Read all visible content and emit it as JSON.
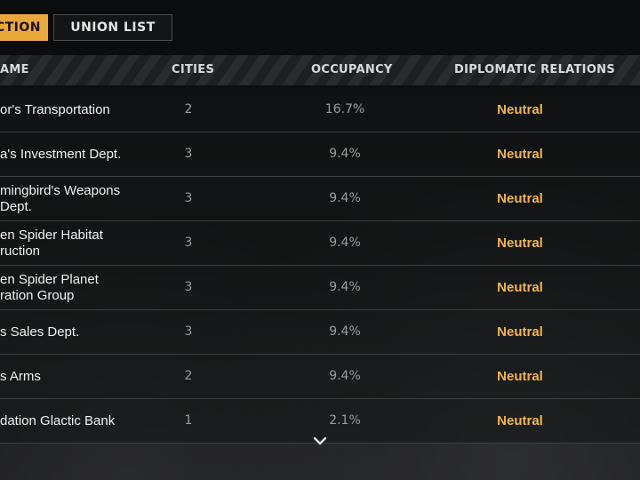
{
  "tabs": {
    "faction_label": "ACTION",
    "union_label": "UNION LIST"
  },
  "columns": {
    "name": "AME",
    "cities": "CITIES",
    "occupancy": "OCCUPANCY",
    "relations": "DIPLOMATIC RELATIONS"
  },
  "rows": [
    {
      "name": "or's Transportation\n ",
      "cities": "2",
      "occupancy": "16.7%",
      "relation": "Neutral"
    },
    {
      "name": "a's Investment Dept.",
      "cities": "3",
      "occupancy": "9.4%",
      "relation": "Neutral"
    },
    {
      "name": "mingbird's Weapons\nDept.",
      "cities": "3",
      "occupancy": "9.4%",
      "relation": "Neutral"
    },
    {
      "name": "en Spider Habitat\nruction",
      "cities": "3",
      "occupancy": "9.4%",
      "relation": "Neutral"
    },
    {
      "name": "en Spider Planet\nration Group",
      "cities": "3",
      "occupancy": "9.4%",
      "relation": "Neutral"
    },
    {
      "name": "s Sales Dept.",
      "cities": "3",
      "occupancy": "9.4%",
      "relation": "Neutral"
    },
    {
      "name": "s Arms",
      "cities": "2",
      "occupancy": "9.4%",
      "relation": "Neutral"
    },
    {
      "name": "dation Glactic Bank",
      "cities": "1",
      "occupancy": "2.1%",
      "relation": "Neutral"
    }
  ],
  "colors": {
    "accent": "#e9a73c",
    "relation_neutral": "#f0b54a"
  },
  "icons": {
    "scroll_down": "chevron-down-icon"
  }
}
